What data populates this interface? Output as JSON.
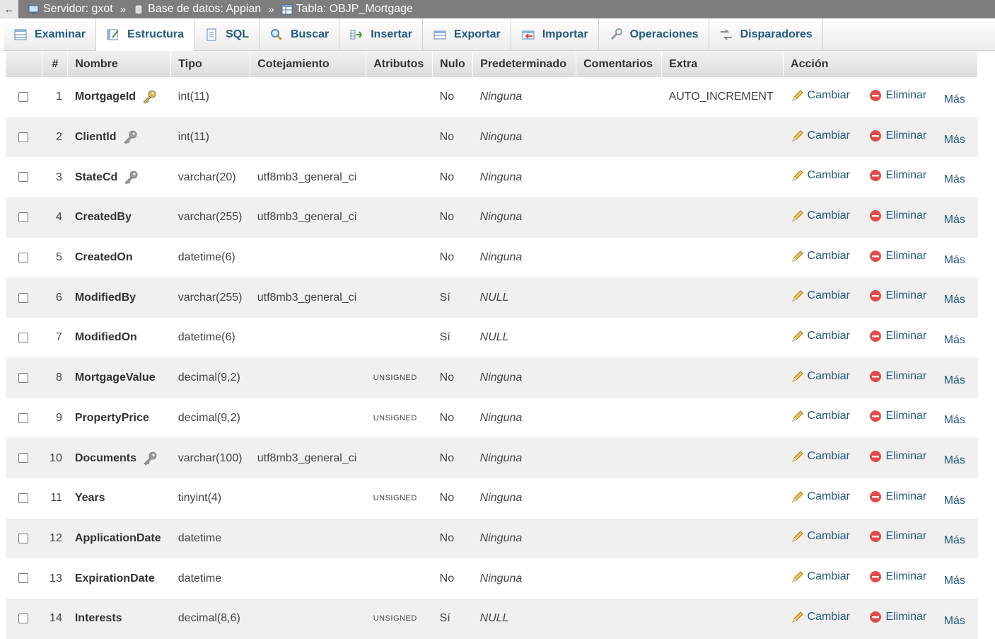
{
  "breadcrumb": {
    "back": "←",
    "server": "Servidor: gxot",
    "database": "Base de datos: Appian",
    "table": "Tabla: OBJP_Mortgage",
    "separator": "»"
  },
  "tabs": [
    {
      "label": "Examinar",
      "icon": "browse-icon"
    },
    {
      "label": "Estructura",
      "icon": "structure-icon"
    },
    {
      "label": "SQL",
      "icon": "sql-icon"
    },
    {
      "label": "Buscar",
      "icon": "search-icon"
    },
    {
      "label": "Insertar",
      "icon": "insert-icon"
    },
    {
      "label": "Exportar",
      "icon": "export-icon"
    },
    {
      "label": "Importar",
      "icon": "import-icon"
    },
    {
      "label": "Operaciones",
      "icon": "wrench-icon"
    },
    {
      "label": "Disparadores",
      "icon": "triggers-icon"
    }
  ],
  "active_tab": "Estructura",
  "headers": [
    "#",
    "Nombre",
    "Tipo",
    "Cotejamiento",
    "Atributos",
    "Nulo",
    "Predeterminado",
    "Comentarios",
    "Extra",
    "Acción"
  ],
  "actions": {
    "change": "Cambiar",
    "drop": "Eliminar",
    "more": "Más"
  },
  "colors": {
    "link": "#235a81",
    "primary_key": "#e2b43a",
    "index_key": "#9a9a9a",
    "drop_icon": "#e24b4b"
  },
  "rows": [
    {
      "num": "1",
      "name": "MortgageId",
      "key": "primary",
      "type": "int(11)",
      "collation": "",
      "attributes": "",
      "null": "No",
      "default": "Ninguna",
      "comments": "",
      "extra": "AUTO_INCREMENT"
    },
    {
      "num": "2",
      "name": "ClientId",
      "key": "index",
      "type": "int(11)",
      "collation": "",
      "attributes": "",
      "null": "No",
      "default": "Ninguna",
      "comments": "",
      "extra": ""
    },
    {
      "num": "3",
      "name": "StateCd",
      "key": "index",
      "type": "varchar(20)",
      "collation": "utf8mb3_general_ci",
      "attributes": "",
      "null": "No",
      "default": "Ninguna",
      "comments": "",
      "extra": ""
    },
    {
      "num": "4",
      "name": "CreatedBy",
      "key": "",
      "type": "varchar(255)",
      "collation": "utf8mb3_general_ci",
      "attributes": "",
      "null": "No",
      "default": "Ninguna",
      "comments": "",
      "extra": ""
    },
    {
      "num": "5",
      "name": "CreatedOn",
      "key": "",
      "type": "datetime(6)",
      "collation": "",
      "attributes": "",
      "null": "No",
      "default": "Ninguna",
      "comments": "",
      "extra": ""
    },
    {
      "num": "6",
      "name": "ModifiedBy",
      "key": "",
      "type": "varchar(255)",
      "collation": "utf8mb3_general_ci",
      "attributes": "",
      "null": "Sí",
      "default": "NULL",
      "comments": "",
      "extra": ""
    },
    {
      "num": "7",
      "name": "ModifiedOn",
      "key": "",
      "type": "datetime(6)",
      "collation": "",
      "attributes": "",
      "null": "Sí",
      "default": "NULL",
      "comments": "",
      "extra": ""
    },
    {
      "num": "8",
      "name": "MortgageValue",
      "key": "",
      "type": "decimal(9,2)",
      "collation": "",
      "attributes": "UNSIGNED",
      "null": "No",
      "default": "Ninguna",
      "comments": "",
      "extra": ""
    },
    {
      "num": "9",
      "name": "PropertyPrice",
      "key": "",
      "type": "decimal(9,2)",
      "collation": "",
      "attributes": "UNSIGNED",
      "null": "No",
      "default": "Ninguna",
      "comments": "",
      "extra": ""
    },
    {
      "num": "10",
      "name": "Documents",
      "key": "index",
      "type": "varchar(100)",
      "collation": "utf8mb3_general_ci",
      "attributes": "",
      "null": "No",
      "default": "Ninguna",
      "comments": "",
      "extra": ""
    },
    {
      "num": "11",
      "name": "Years",
      "key": "",
      "type": "tinyint(4)",
      "collation": "",
      "attributes": "UNSIGNED",
      "null": "No",
      "default": "Ninguna",
      "comments": "",
      "extra": ""
    },
    {
      "num": "12",
      "name": "ApplicationDate",
      "key": "",
      "type": "datetime",
      "collation": "",
      "attributes": "",
      "null": "No",
      "default": "Ninguna",
      "comments": "",
      "extra": ""
    },
    {
      "num": "13",
      "name": "ExpirationDate",
      "key": "",
      "type": "datetime",
      "collation": "",
      "attributes": "",
      "null": "No",
      "default": "Ninguna",
      "comments": "",
      "extra": ""
    },
    {
      "num": "14",
      "name": "Interests",
      "key": "",
      "type": "decimal(8,6)",
      "collation": "",
      "attributes": "UNSIGNED",
      "null": "Sí",
      "default": "NULL",
      "comments": "",
      "extra": ""
    }
  ]
}
